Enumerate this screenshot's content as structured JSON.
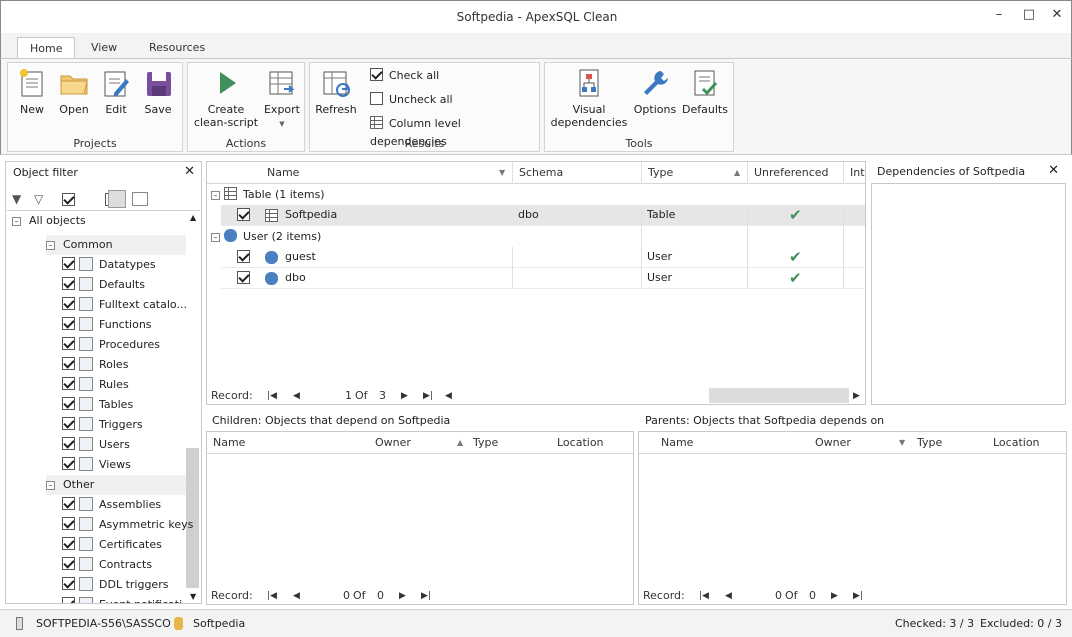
{
  "window": {
    "title": "Softpedia - ApexSQL Clean"
  },
  "tabs": [
    {
      "label": "Home",
      "active": true
    },
    {
      "label": "View",
      "active": false
    },
    {
      "label": "Resources",
      "active": false
    }
  ],
  "ribbon": {
    "projects": {
      "label": "Projects",
      "new": "New",
      "open": "Open",
      "edit": "Edit",
      "save": "Save"
    },
    "actions": {
      "label": "Actions",
      "create_line1": "Create",
      "create_line2": "clean-script",
      "export": "Export"
    },
    "results": {
      "label": "Results",
      "refresh": "Refresh",
      "check_all": "Check all",
      "uncheck_all": "Uncheck all",
      "column_deps": "Column level dependencies"
    },
    "tools": {
      "label": "Tools",
      "visual_line1": "Visual",
      "visual_line2": "dependencies",
      "options": "Options",
      "defaults": "Defaults"
    }
  },
  "object_filter": {
    "title": "Object filter",
    "root": "All objects",
    "common_label": "Common",
    "common_items": [
      "Datatypes",
      "Defaults",
      "Fulltext catalo...",
      "Functions",
      "Procedures",
      "Roles",
      "Rules",
      "Tables",
      "Triggers",
      "Users",
      "Views"
    ],
    "other_label": "Other",
    "other_items": [
      "Assemblies",
      "Asymmetric keys",
      "Certificates",
      "Contracts",
      "DDL triggers",
      "Event notificati..."
    ]
  },
  "main_grid": {
    "columns": [
      "Name",
      "Schema",
      "Type",
      "Unreferenced",
      "Inte"
    ],
    "groups": [
      {
        "label": "Table (1 items)",
        "rows": [
          {
            "name": "Softpedia",
            "schema": "dbo",
            "type": "Table"
          }
        ]
      },
      {
        "label": "User (2 items)",
        "rows": [
          {
            "name": "guest",
            "schema": "",
            "type": "User"
          },
          {
            "name": "dbo",
            "schema": "",
            "type": "User"
          }
        ]
      }
    ],
    "pager": {
      "label": "Record:",
      "current": "1",
      "of": "Of",
      "total": "3"
    }
  },
  "dependencies": {
    "title": "Dependencies of Softpedia"
  },
  "children": {
    "title": "Children: Objects that depend on Softpedia",
    "columns": [
      "Name",
      "Owner",
      "Type",
      "Location"
    ],
    "pager": {
      "label": "Record:",
      "current": "0",
      "of": "Of",
      "total": "0"
    }
  },
  "parents": {
    "title": "Parents: Objects that Softpedia depends on",
    "columns": [
      "Name",
      "Owner",
      "Type",
      "Location"
    ],
    "pager": {
      "label": "Record:",
      "current": "0",
      "of": "Of",
      "total": "0"
    }
  },
  "status": {
    "server": "SOFTPEDIA-S56\\SASSCO",
    "database": "Softpedia",
    "checked": "Checked: 3 / 3",
    "excluded": "Excluded: 0 / 3"
  },
  "colors": {
    "accent": "#2f6fb5",
    "green_check": "#3f8f5b",
    "selected_row": "#e6e6e6"
  }
}
